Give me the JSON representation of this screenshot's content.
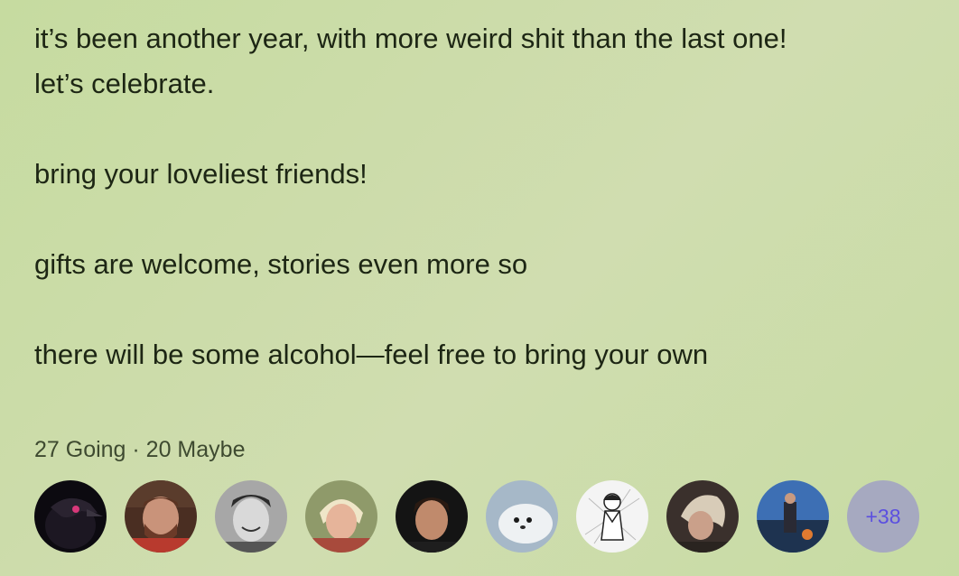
{
  "event": {
    "description_lines": [
      "it’s been another year, with more weird shit than the last one!",
      "let’s celebrate.",
      "bring your loveliest friends!",
      "gifts are welcome, stories even more so",
      "there will be some alcohol—feel free to bring your own"
    ],
    "rsvp": {
      "summary": "27 Going · 20 Maybe"
    },
    "attendees": {
      "avatars": [
        {
          "icon": "raven-avatar-icon"
        },
        {
          "icon": "bearded-man-avatar-icon"
        },
        {
          "icon": "smiling-man-bw-avatar-icon"
        },
        {
          "icon": "blonde-person-avatar-icon"
        },
        {
          "icon": "young-man-avatar-icon"
        },
        {
          "icon": "seal-pup-avatar-icon"
        },
        {
          "icon": "manga-drawing-avatar-icon"
        },
        {
          "icon": "blonde-woman-avatar-icon"
        },
        {
          "icon": "blue-scene-avatar-icon"
        }
      ],
      "more_label": "+38"
    }
  },
  "colors": {
    "background": "#cadba6",
    "text": "#1d2614",
    "more_badge_bg": "#a6a9c0",
    "more_badge_text": "#5b4fe0"
  }
}
